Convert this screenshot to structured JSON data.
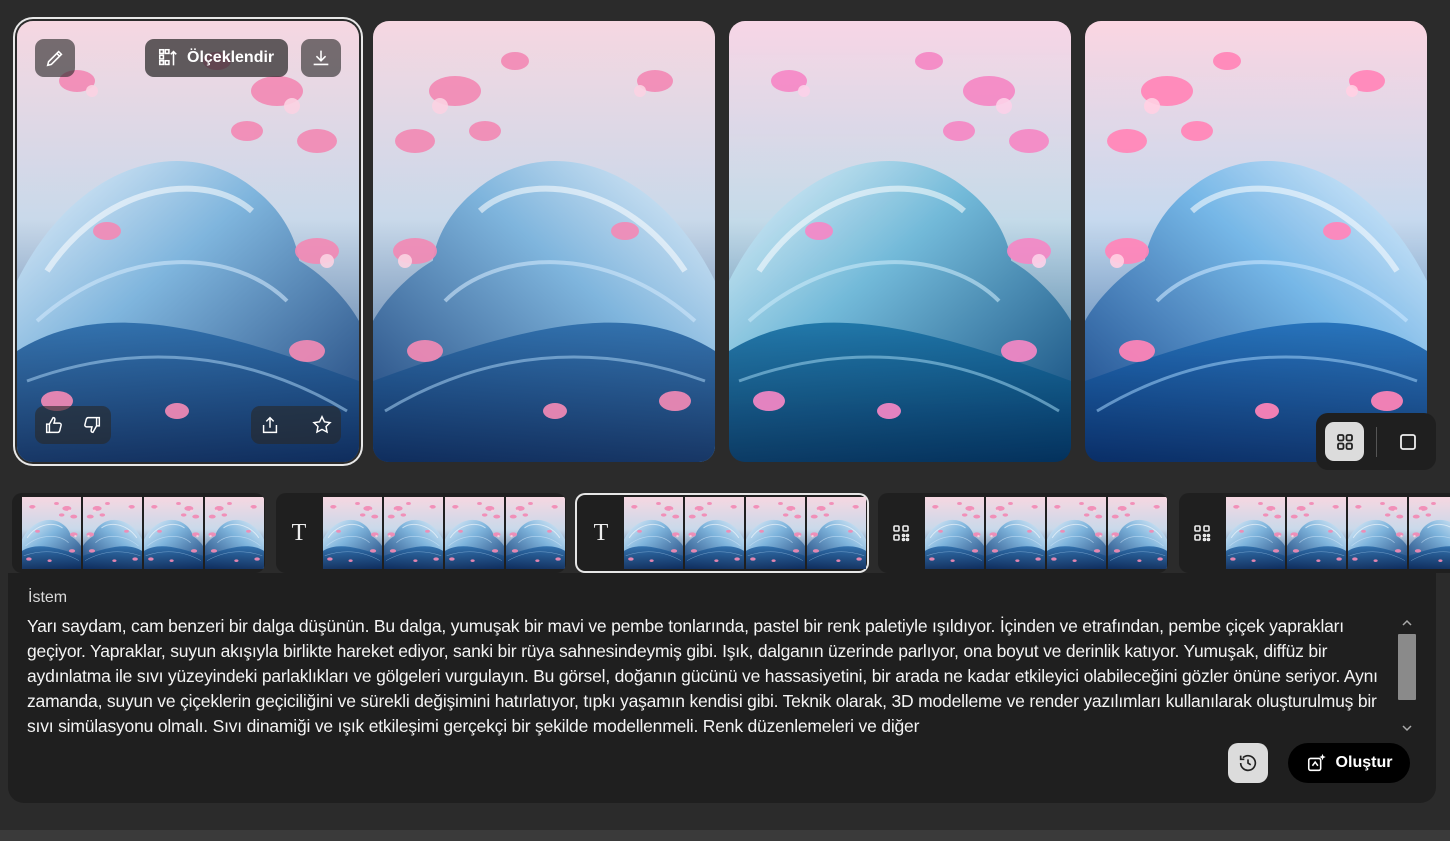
{
  "main_images": {
    "upscale_label": "Ölçeklendir",
    "icons": {
      "edit": "pencil-icon",
      "upscale": "upscale-icon",
      "download": "download-icon",
      "like": "thumbs-up-icon",
      "dislike": "thumbs-down-icon",
      "share": "share-icon",
      "favorite": "star-icon"
    }
  },
  "layout_toggle": {
    "options": [
      "grid-view-icon",
      "single-view-icon"
    ],
    "selected": "grid"
  },
  "history_strips": [
    {
      "glyph": "none",
      "thumbs": 4
    },
    {
      "glyph": "T",
      "thumbs": 4
    },
    {
      "glyph": "T",
      "thumbs": 4,
      "active": true
    },
    {
      "glyph": "style-grid-icon",
      "thumbs": 4
    },
    {
      "glyph": "style-grid-icon",
      "thumbs": 4
    }
  ],
  "prompt": {
    "label": "İstem",
    "text": "Yarı saydam, cam benzeri bir dalga düşünün. Bu dalga, yumuşak bir mavi ve pembe tonlarında, pastel bir renk paletiyle ışıldıyor. İçinden ve etrafından, pembe çiçek yaprakları geçiyor. Yapraklar, suyun akışıyla birlikte hareket ediyor, sanki bir rüya sahnesindeymiş gibi. Işık, dalganın üzerinde parlıyor, ona boyut ve derinlik katıyor. Yumuşak, diffüz bir aydınlatma ile sıvı yüzeyindeki parlaklıkları ve gölgeleri vurgulayın. Bu görsel, doğanın gücünü ve hassasiyetini, bir arada ne kadar etkileyici olabileceğini gözler önüne seriyor. Aynı zamanda, suyun ve çiçeklerin geçiciliğini ve sürekli değişimini hatırlatıyor, tıpkı yaşamın kendisi gibi. Teknik olarak, 3D modelleme ve render yazılımları kullanılarak oluşturulmuş bir sıvı simülasyonu olmalı. Sıvı dinamiği ve ışık etkileşimi gerçekçi bir şekilde modellenmeli. Renk düzenlemeleri ve diğer"
  },
  "actions": {
    "history_icon": "history-icon",
    "generate_label": "Oluştur",
    "generate_icon": "sparkle-generate-icon"
  },
  "colors": {
    "background": "#2b2b2b",
    "panel": "#1f1f1f",
    "petal_pink": "#f28ab5",
    "water_blue": "#3a7fb8"
  }
}
